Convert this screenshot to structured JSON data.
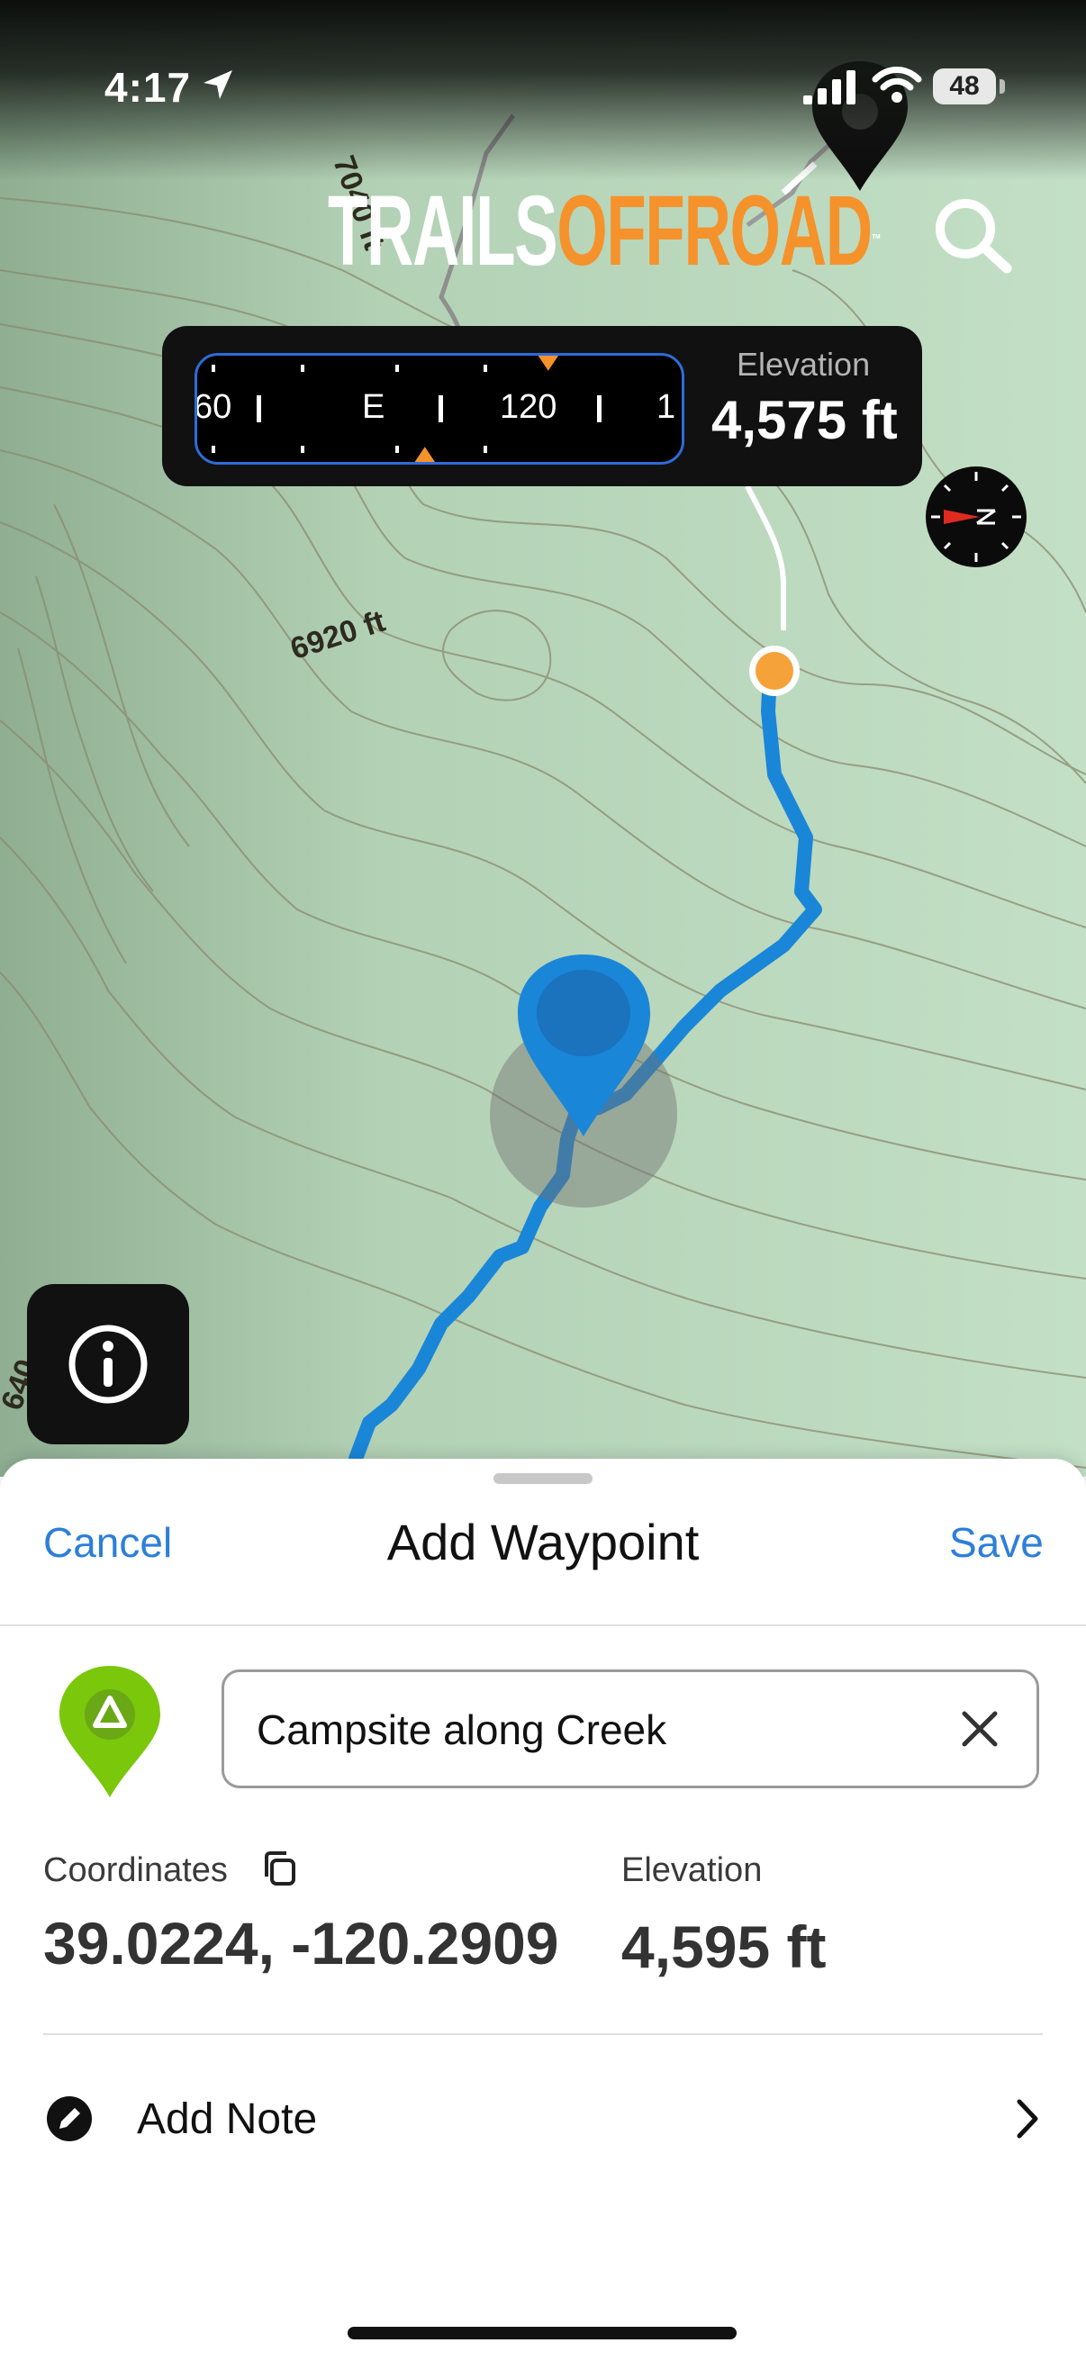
{
  "status_bar": {
    "time": "4:17",
    "battery": "48",
    "icons": [
      "location-arrow-icon",
      "signal-icon",
      "wifi-icon",
      "battery-icon"
    ]
  },
  "header": {
    "logo_part1": "TRAILS",
    "logo_part2": "OFFROAD",
    "logo_tm": "™",
    "search_icon": "search-icon"
  },
  "heading_hud": {
    "strip_labels": [
      "60",
      "E",
      "120",
      "1"
    ],
    "elevation_label": "Elevation",
    "elevation_value": "4,575 ft"
  },
  "map": {
    "contour_labels": [
      "7040 ft",
      "6920 ft",
      "640"
    ],
    "colors": {
      "terrain": "#bcdcbf",
      "route": "#1a86d8",
      "trail": "#ffffff",
      "start_dot": "#f5a23a"
    }
  },
  "add_waypoint_sheet": {
    "cancel_label": "Cancel",
    "title": "Add Waypoint",
    "save_label": "Save",
    "waypoint_icon": "campsite-pin-icon",
    "name_value": "Campsite along Creek",
    "coordinates_label": "Coordinates",
    "coordinates_value": "39.0224, -120.2909",
    "elevation_label": "Elevation",
    "elevation_value": "4,595 ft",
    "note_label": "Add Note",
    "accent_color": "#2c7fd9",
    "pin_color": "#7ac70c"
  }
}
